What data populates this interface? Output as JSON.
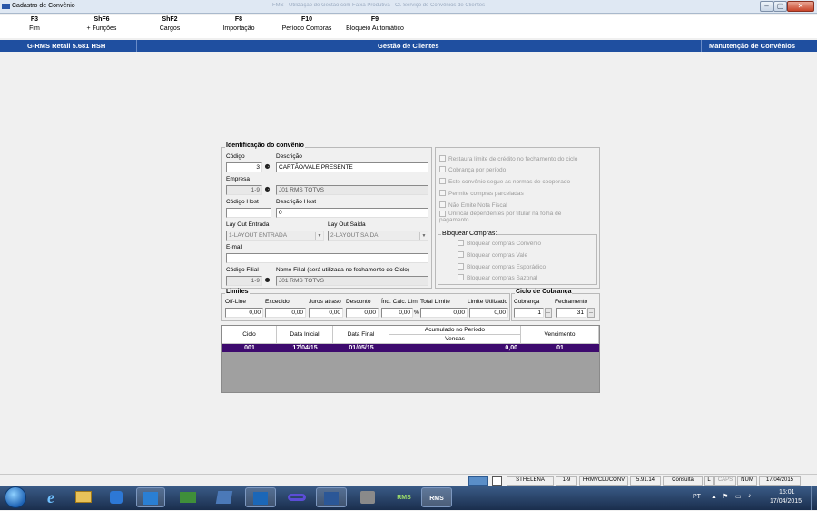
{
  "window": {
    "title": "Cadastro de Convênio",
    "blurred_caption": "FMS - Utilização de Gestão com Faixa Produtiva - Cl. Serviço de Convênios de Clientes",
    "controls": {
      "min": "–",
      "max": "▢",
      "close": "✕"
    }
  },
  "fkeys": [
    {
      "key": "F3",
      "label": "Fim"
    },
    {
      "key": "ShF6",
      "label": "+ Funções"
    },
    {
      "key": "ShF2",
      "label": "Cargos"
    },
    {
      "key": "F8",
      "label": "Importação"
    },
    {
      "key": "F10",
      "label": "Período Compras"
    },
    {
      "key": "F9",
      "label": "Bloqueio Automático"
    }
  ],
  "header": {
    "app": "G-RMS Retail 5.681 HSH",
    "section": "Gestão de Clientes",
    "screen": "Manutenção de Convênios"
  },
  "form": {
    "legend": "Identificação do convênio",
    "codigo_label": "Código",
    "codigo_value": "3",
    "descricao_label": "Descrição",
    "descricao_value": "CARTÃO/VALE PRESENTE",
    "empresa_label": "Empresa",
    "empresa_code": "1-9",
    "empresa_name": "J01 RMS TOTVS",
    "codigo_host_label": "Código Host",
    "codigo_host_value": "",
    "descricao_host_label": "Descrição Host",
    "descricao_host_value": "0",
    "layout_entrada_label": "Lay Out Entrada",
    "layout_entrada_value": "1-LAYOUT ENTRADA",
    "layout_saida_label": "Lay Out Saída",
    "layout_saida_value": "2-LAYOUT SAIDA",
    "email_label": "E-mail",
    "email_value": "",
    "codigo_filial_label": "Código Filial",
    "codigo_filial_value": "1-9",
    "nome_filial_label": "Nome Filial (será utilizada no fechamento do Ciclo)",
    "nome_filial_value": "J01 RMS TOTVS"
  },
  "options": [
    "Restaura limite de crédito no fechamento do ciclo",
    "Cobrança por período",
    "Este convênio segue as normas de cooperado",
    "Permite compras parceladas",
    "Não Emite Nota Fiscal",
    "Unificar dependentes por titular na folha de pagamento"
  ],
  "bloquear": {
    "legend": "Bloquear Compras:",
    "items": [
      "Bloquear compras Convênio",
      "Bloquear compras Vale",
      "Bloquear compras Esporádico",
      "Bloquear compras Sazonal"
    ]
  },
  "limites": {
    "legend": "Limites",
    "off_line": {
      "label": "Off-Line",
      "value": "0,00"
    },
    "excedido": {
      "label": "Excedido",
      "value": "0,00"
    },
    "juros": {
      "label": "Juros atraso",
      "value": "0,00"
    },
    "desconto": {
      "label": "Desconto",
      "value": "0,00"
    },
    "indice": {
      "label": "Índ. Cálc. Lim",
      "value": "0,00",
      "unit": "%"
    },
    "total": {
      "label": "Total Limite",
      "value": "0,00"
    },
    "utilizado": {
      "label": "Limite Utilizado",
      "value": "0,00"
    }
  },
  "ciclo_cobranca": {
    "legend": "Ciclo de Cobrança",
    "cobranca_label": "Cobrança",
    "cobranca_value": "1",
    "fechamento_label": "Fechamento",
    "fechamento_value": "31"
  },
  "grid": {
    "headers": {
      "ciclo": "Ciclo",
      "data_inicial": "Data Inicial",
      "data_final": "Data Final",
      "acumulado": "Acumulado no Período",
      "vendas": "Vendas",
      "vencimento": "Vencimento"
    },
    "row": {
      "ciclo": "001",
      "data_inicial": "17/04/15",
      "data_final": "01/05/15",
      "vendas": "0,00",
      "vencimento": "01"
    }
  },
  "statusbar": {
    "user": "STHELENA",
    "company": "1-9",
    "program": "FRMVCLUCONV",
    "version": "5.91.14",
    "mode": "Consulta",
    "l": "L",
    "caps": "CAPS",
    "num": "NUM",
    "date": "17/04/2015"
  },
  "taskbar": {
    "apps": [
      "internet-explorer",
      "file-explorer",
      "media-player",
      "lync",
      "money-app",
      "virtualbox",
      "outlook",
      "network-app",
      "word",
      "tools-app",
      "rms-app-1",
      "rms-app-2"
    ],
    "rms_label": "RMS",
    "language": "PT",
    "time": "15:01",
    "date": "17/04/2015"
  },
  "colors": {
    "header_blue": "#1f4fa0",
    "selected_row": "#3d0a6e"
  }
}
